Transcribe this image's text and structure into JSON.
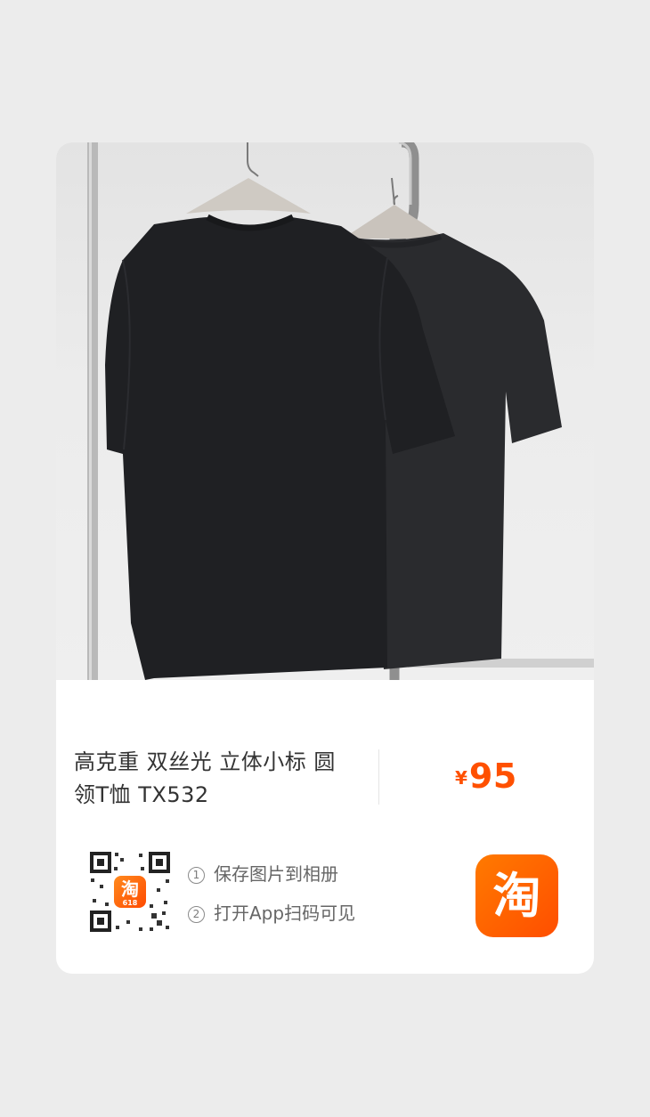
{
  "product": {
    "title_line1": "高克重 双丝光 立体小标 圆",
    "title_line2": "领T恤 TX532",
    "currency": "¥",
    "price": "95"
  },
  "share": {
    "step1_num": "①",
    "step1": "保存图片到相册",
    "step2_num": "②",
    "step2": "打开App扫码可见",
    "qr_logo_char": "淘",
    "qr_logo_sub": "618",
    "brand_logo_char": "淘"
  },
  "colors": {
    "price": "#ff5000",
    "brand_orange": "#ff5a00"
  },
  "icons": {
    "qr_code": "qr-code-icon",
    "brand": "taobao-logo-icon"
  }
}
